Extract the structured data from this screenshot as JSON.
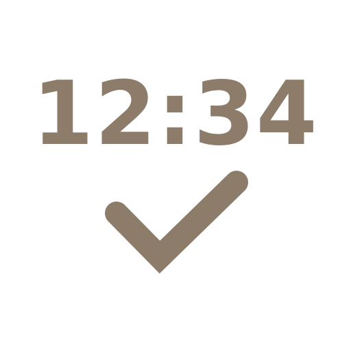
{
  "clock": {
    "time_text": "12:34"
  },
  "icons": {
    "check": "checkmark-icon"
  },
  "colors": {
    "background": "#ffffff",
    "icon": "#8c7c69"
  }
}
